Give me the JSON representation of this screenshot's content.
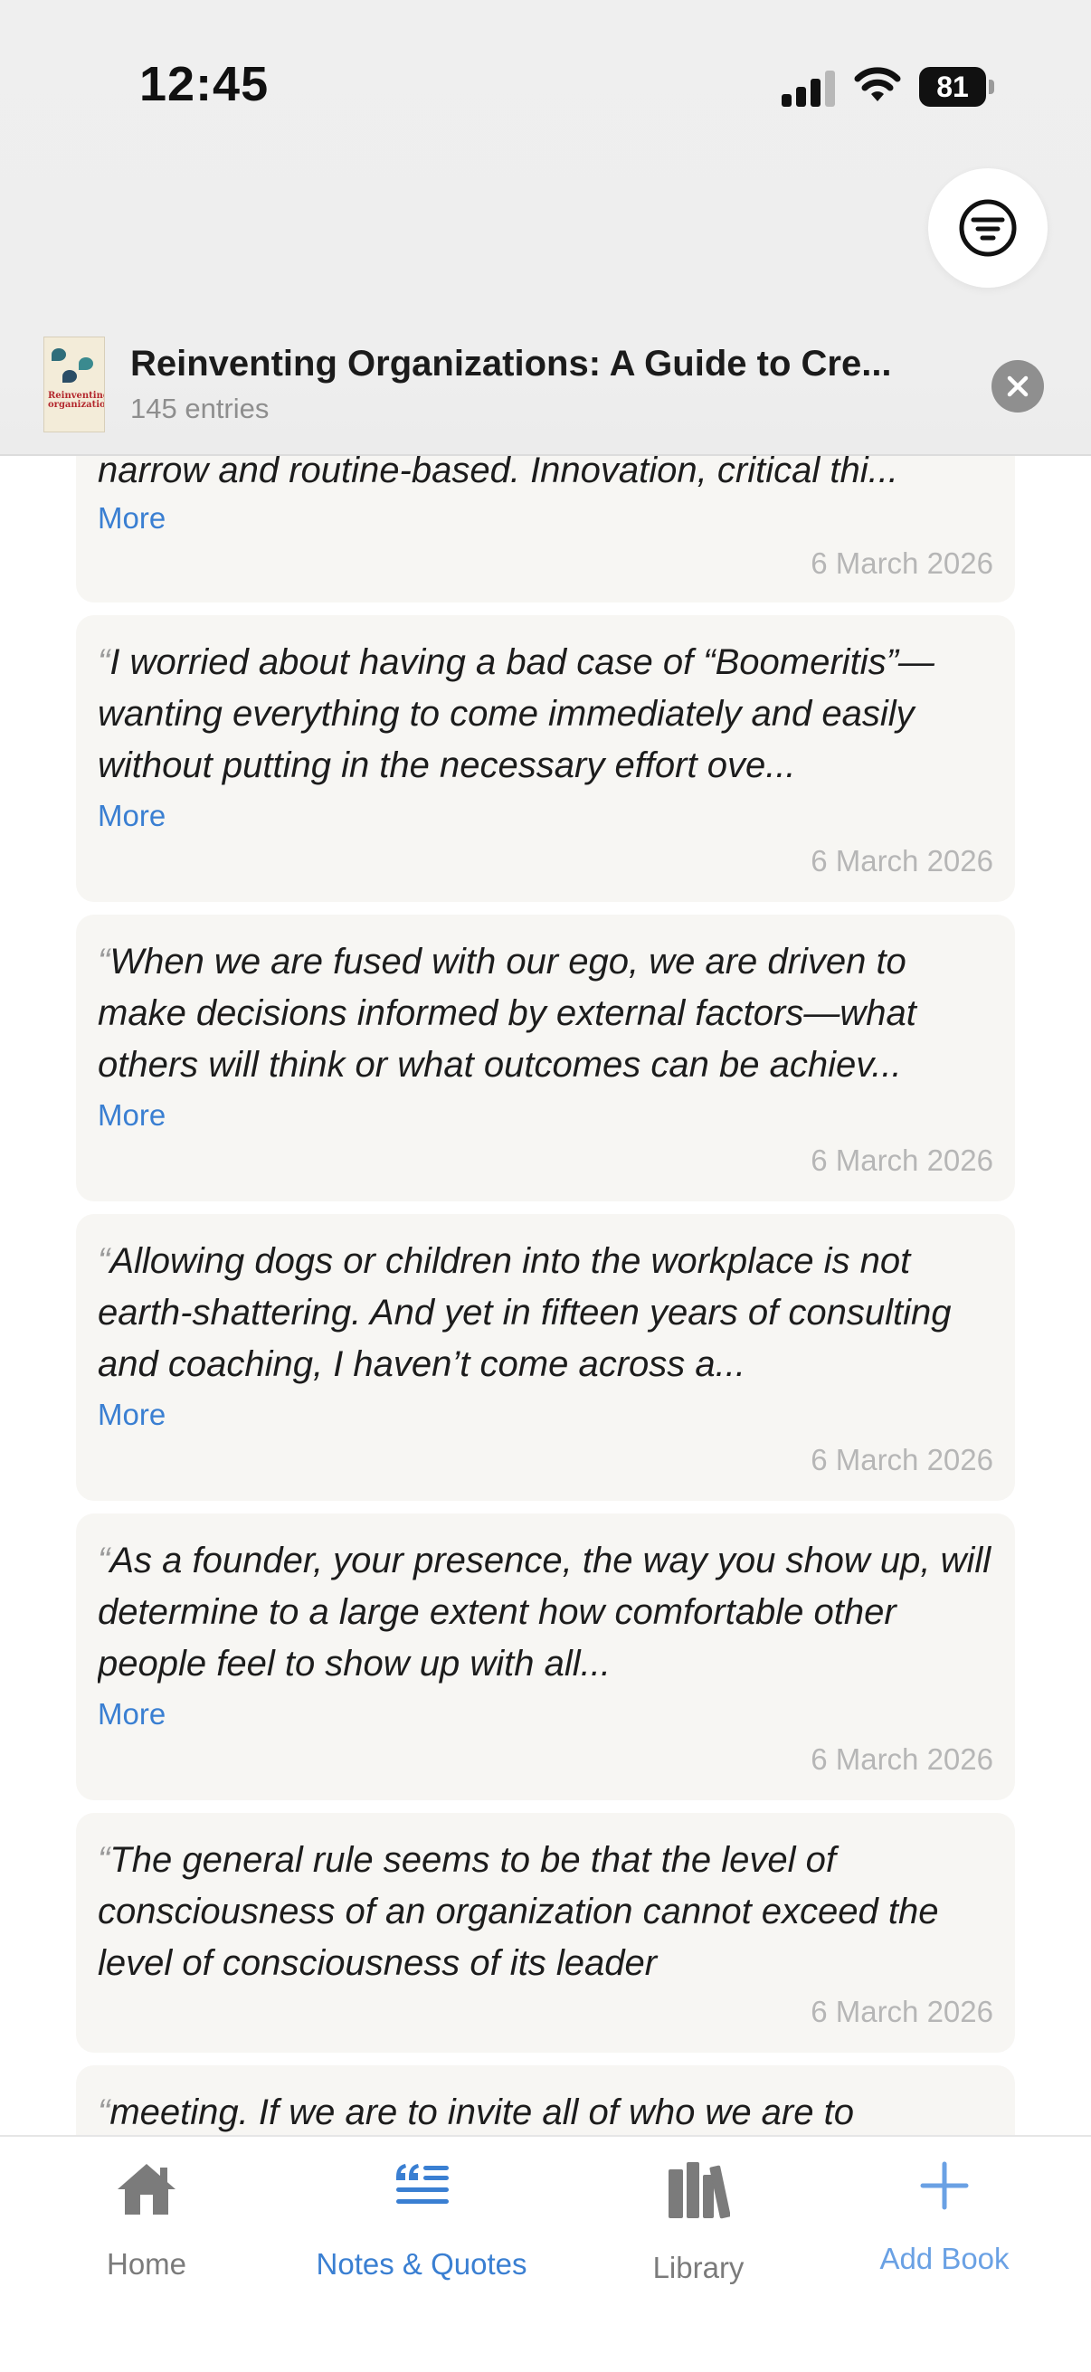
{
  "status_bar": {
    "time": "12:45",
    "battery": "81"
  },
  "header": {
    "book_title": "Reinventing Organizations: A Guide to Cre...",
    "entries_count": "145 entries",
    "cover_title": "Reinventing organizations",
    "filter_icon": "filter-lines-icon",
    "close_icon": "close-x-icon"
  },
  "entries": [
    {
      "quote": "narrow and routine-based. Innovation, critical thi...",
      "more": "More",
      "date": "6 March 2026"
    },
    {
      "quote": "I worried about having a bad case of “Boomeritis”—wanting everything to come immediately and easily without putting in the necessary effort ove...",
      "more": "More",
      "date": "6 March 2026"
    },
    {
      "quote": "When we are fused with our ego, we are driven to make decisions informed by external factors—what others will think or what outcomes can be achiev...",
      "more": "More",
      "date": "6 March 2026"
    },
    {
      "quote": "Allowing dogs or children into the workplace is not earth-shattering. And yet in fifteen years of consulting and coaching, I haven’t come across a...",
      "more": "More",
      "date": "6 March 2026"
    },
    {
      "quote": "As a founder, your presence, the way you show up, will determine to a large extent how comfortable other people feel to show up with all...",
      "more": "More",
      "date": "6 March 2026"
    },
    {
      "quote": "The general rule seems to be that the level of consciousness of an organization cannot exceed the level of consciousness of its leader",
      "date": "6 March 2026"
    },
    {
      "quote": "meeting. If we are to invite all of who we are to"
    }
  ],
  "tab_bar": {
    "tabs": [
      {
        "label": "Home",
        "icon": "home-icon",
        "active": false
      },
      {
        "label": "Notes & Quotes",
        "icon": "quote-lines-icon",
        "active": true
      },
      {
        "label": "Library",
        "icon": "books-icon",
        "active": false
      },
      {
        "label": "Add Book",
        "icon": "plus-icon",
        "active": false
      }
    ]
  },
  "colors": {
    "accent": "#3a7fd2",
    "card_background": "#f7f6f3",
    "date_text": "#b6b6b6"
  }
}
